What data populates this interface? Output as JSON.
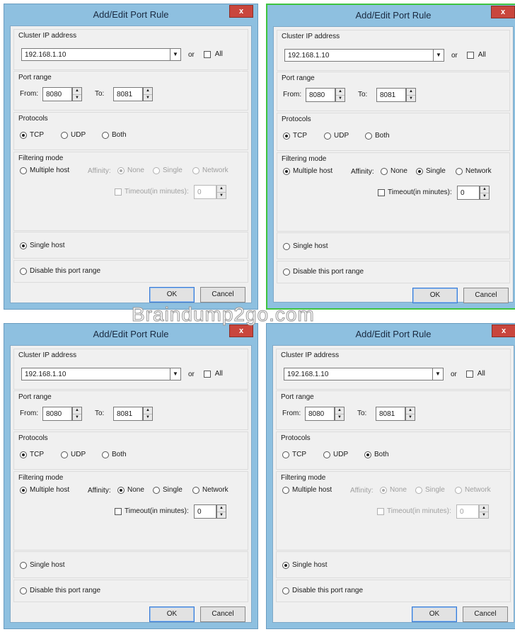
{
  "dialogs": [
    {
      "title": "Add/Edit Port Rule",
      "close": "x",
      "cluster_label": "Cluster IP address",
      "ip": "192.168.1.10",
      "or": "or",
      "all": "All",
      "port_label": "Port range",
      "from_label": "From:",
      "from": "8080",
      "to_label": "To:",
      "to": "8081",
      "protocols_label": "Protocols",
      "tcp": "TCP",
      "udp": "UDP",
      "both": "Both",
      "filtering_label": "Filtering mode",
      "multiple": "Multiple host",
      "affinity": "Affinity:",
      "none": "None",
      "single": "Single",
      "network": "Network",
      "timeout": "Timeout(in minutes):",
      "timeout_val": "0",
      "single_host": "Single host",
      "disable": "Disable this port range",
      "ok": "OK",
      "cancel": "Cancel",
      "protocol_selected": "TCP",
      "filtering_selected": "Single host",
      "affinity_selected": "None",
      "affinity_enabled": false
    },
    {
      "title": "Add/Edit Port Rule",
      "close": "x",
      "cluster_label": "Cluster IP address",
      "ip": "192.168.1.10",
      "or": "or",
      "all": "All",
      "port_label": "Port range",
      "from_label": "From:",
      "from": "8080",
      "to_label": "To:",
      "to": "8081",
      "protocols_label": "Protocols",
      "tcp": "TCP",
      "udp": "UDP",
      "both": "Both",
      "filtering_label": "Filtering mode",
      "multiple": "Multiple host",
      "affinity": "Affinity:",
      "none": "None",
      "single": "Single",
      "network": "Network",
      "timeout": "Timeout(in minutes):",
      "timeout_val": "0",
      "single_host": "Single host",
      "disable": "Disable this port range",
      "ok": "OK",
      "cancel": "Cancel",
      "protocol_selected": "TCP",
      "filtering_selected": "Multiple host",
      "affinity_selected": "Single",
      "affinity_enabled": true
    },
    {
      "title": "Add/Edit Port Rule",
      "close": "x",
      "cluster_label": "Cluster IP address",
      "ip": "192.168.1.10",
      "or": "or",
      "all": "All",
      "port_label": "Port range",
      "from_label": "From:",
      "from": "8080",
      "to_label": "To:",
      "to": "8081",
      "protocols_label": "Protocols",
      "tcp": "TCP",
      "udp": "UDP",
      "both": "Both",
      "filtering_label": "Filtering mode",
      "multiple": "Multiple host",
      "affinity": "Affinity:",
      "none": "None",
      "single": "Single",
      "network": "Network",
      "timeout": "Timeout(in minutes):",
      "timeout_val": "0",
      "single_host": "Single host",
      "disable": "Disable this port range",
      "ok": "OK",
      "cancel": "Cancel",
      "protocol_selected": "TCP",
      "filtering_selected": "Multiple host",
      "affinity_selected": "None",
      "affinity_enabled": true
    },
    {
      "title": "Add/Edit Port Rule",
      "close": "x",
      "cluster_label": "Cluster IP address",
      "ip": "192.168.1.10",
      "or": "or",
      "all": "All",
      "port_label": "Port range",
      "from_label": "From:",
      "from": "8080",
      "to_label": "To:",
      "to": "8081",
      "protocols_label": "Protocols",
      "tcp": "TCP",
      "udp": "UDP",
      "both": "Both",
      "filtering_label": "Filtering mode",
      "multiple": "Multiple host",
      "affinity": "Affinity:",
      "none": "None",
      "single": "Single",
      "network": "Network",
      "timeout": "Timeout(in minutes):",
      "timeout_val": "0",
      "single_host": "Single host",
      "disable": "Disable this port range",
      "ok": "OK",
      "cancel": "Cancel",
      "protocol_selected": "Both",
      "filtering_selected": "Single host",
      "affinity_selected": "None",
      "affinity_enabled": false
    }
  ],
  "selected_dialog": 2,
  "watermark": "Braindump2go.com",
  "colors": {
    "frame": "#8ec0e0",
    "close": "#c9463d",
    "selection_border": "#3fc43f",
    "default_button_border": "#3a7bd5"
  }
}
